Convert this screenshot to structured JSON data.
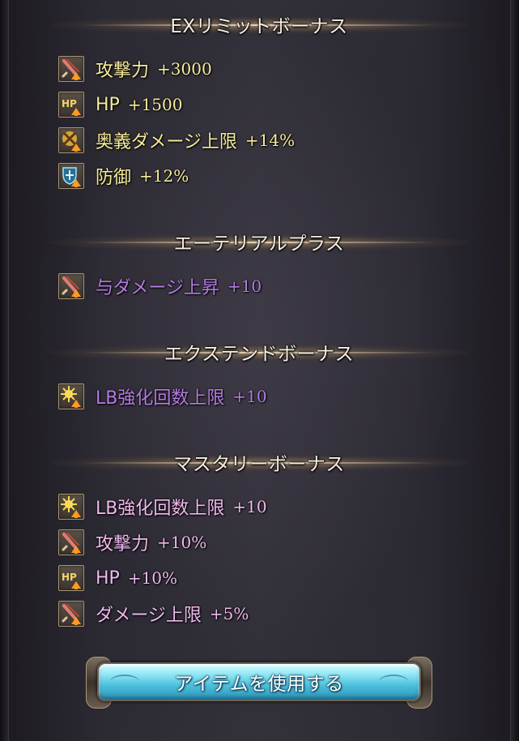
{
  "sections": [
    {
      "title": "EXリミットボーナス",
      "items": [
        {
          "icon": "attack-up-icon",
          "label": "攻撃力",
          "value": "+3000",
          "color": "#f7ec9a"
        },
        {
          "icon": "hp-up-icon",
          "label": "HP",
          "value": "+1500",
          "color": "#f7ec9a"
        },
        {
          "icon": "ougi-cap-up-icon",
          "label": "奥義ダメージ上限",
          "value": "+14%",
          "color": "#f7ec9a"
        },
        {
          "icon": "defense-up-icon",
          "label": "防御",
          "value": "+12%",
          "color": "#f7ec9a"
        }
      ]
    },
    {
      "title": "エーテリアルプラス",
      "items": [
        {
          "icon": "damage-up-icon",
          "label": "与ダメージ上昇",
          "value": "+10",
          "color": "#b57ce2"
        }
      ]
    },
    {
      "title": "エクステンドボーナス",
      "items": [
        {
          "icon": "lb-limit-up-icon",
          "label": "LB強化回数上限",
          "value": "+10",
          "color": "#b57ce2"
        }
      ]
    },
    {
      "title": "マスタリーボーナス",
      "items": [
        {
          "icon": "lb-limit-up-icon",
          "label": "LB強化回数上限",
          "value": "+10",
          "color": "#f0b9ef"
        },
        {
          "icon": "attack-up-icon",
          "label": "攻撃力",
          "value": "+10%",
          "color": "#f0b9ef"
        },
        {
          "icon": "hp-up-icon",
          "label": "HP",
          "value": "+10%",
          "color": "#f0b9ef"
        },
        {
          "icon": "damage-cap-up-icon",
          "label": "ダメージ上限",
          "value": "+5%",
          "color": "#f0b9ef"
        }
      ]
    }
  ],
  "button": {
    "label": "アイテムを使用する"
  }
}
